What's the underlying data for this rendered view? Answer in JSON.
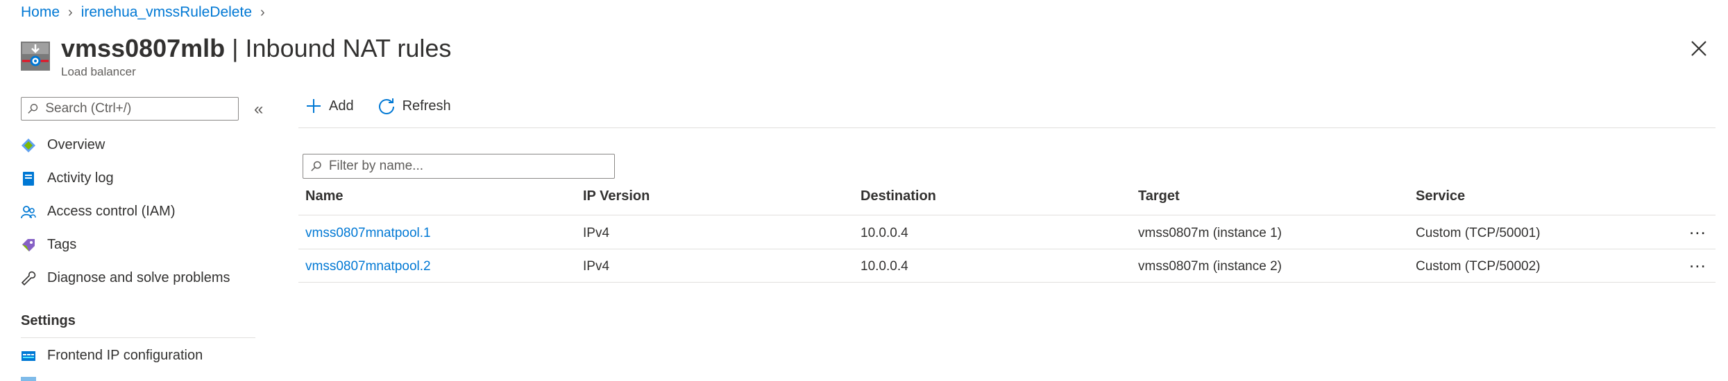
{
  "breadcrumb": {
    "home": "Home",
    "parent": "irenehua_vmssRuleDelete"
  },
  "header": {
    "resource_name": "vmss0807mlb",
    "separator": " | ",
    "page_title": "Inbound NAT rules",
    "resource_type": "Load balancer"
  },
  "sidebar": {
    "search_placeholder": "Search (Ctrl+/)",
    "items": [
      {
        "label": "Overview",
        "icon": "overview-icon"
      },
      {
        "label": "Activity log",
        "icon": "activity-log-icon"
      },
      {
        "label": "Access control (IAM)",
        "icon": "iam-icon"
      },
      {
        "label": "Tags",
        "icon": "tag-icon"
      },
      {
        "label": "Diagnose and solve problems",
        "icon": "wrench-icon"
      }
    ],
    "settings_heading": "Settings",
    "settings_items": [
      {
        "label": "Frontend IP configuration",
        "icon": "frontend-ip-icon"
      }
    ]
  },
  "toolbar": {
    "add_label": "Add",
    "refresh_label": "Refresh"
  },
  "filter": {
    "placeholder": "Filter by name..."
  },
  "table": {
    "columns": [
      "Name",
      "IP Version",
      "Destination",
      "Target",
      "Service"
    ],
    "rows": [
      {
        "name": "vmss0807mnatpool.1",
        "ip_version": "IPv4",
        "destination": "10.0.0.4",
        "target": "vmss0807m (instance 1)",
        "service": "Custom (TCP/50001)",
        "more": "..."
      },
      {
        "name": "vmss0807mnatpool.2",
        "ip_version": "IPv4",
        "destination": "10.0.0.4",
        "target": "vmss0807m (instance 2)",
        "service": "Custom (TCP/50002)",
        "more": "..."
      }
    ]
  },
  "colors": {
    "accent": "#0078d4",
    "text": "#323130",
    "border": "#e1dfdd"
  }
}
